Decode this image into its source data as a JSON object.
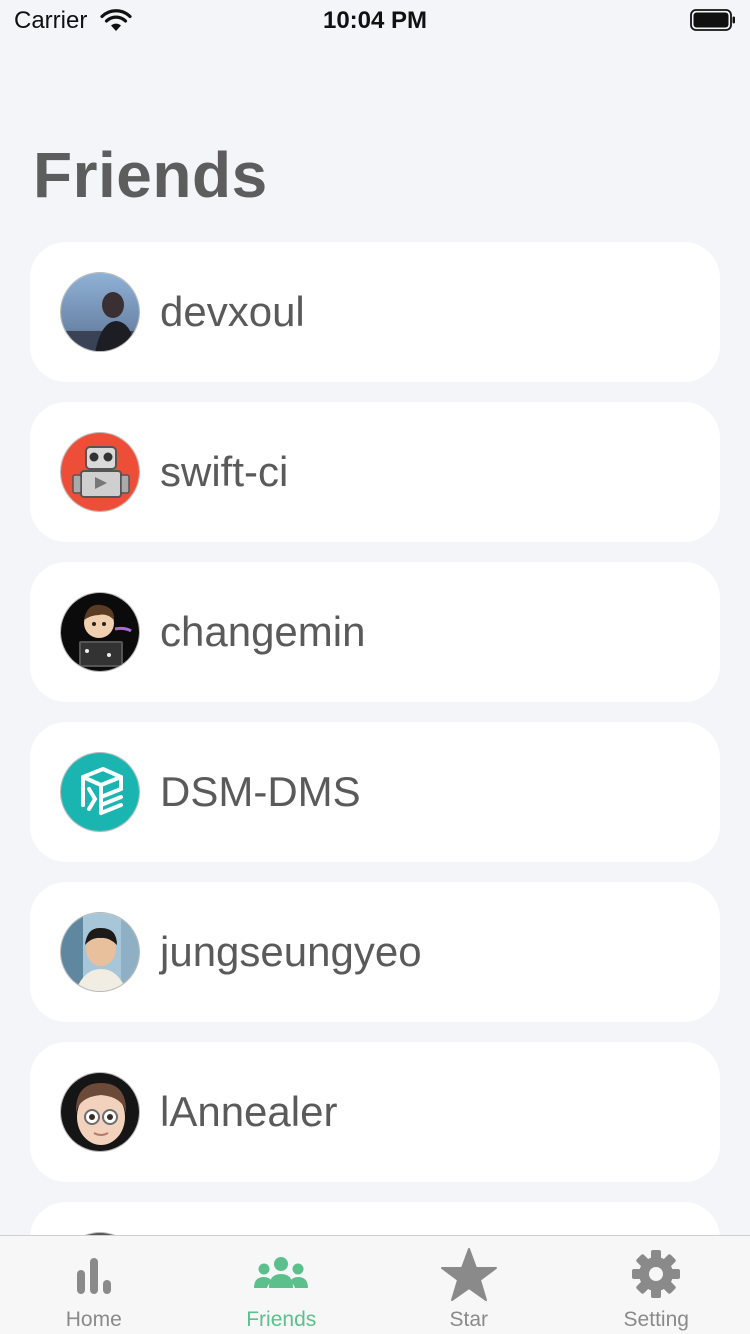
{
  "status_bar": {
    "carrier": "Carrier",
    "time": "10:04 PM"
  },
  "page": {
    "title": "Friends"
  },
  "friends": [
    {
      "name": "devxoul",
      "avatar": "photo-portrait-dusk"
    },
    {
      "name": "swift-ci",
      "avatar": "robot-icon"
    },
    {
      "name": "changemin",
      "avatar": "cartoon-boy"
    },
    {
      "name": "DSM-DMS",
      "avatar": "dms-logo"
    },
    {
      "name": "jungseungyeo",
      "avatar": "photo-portrait-window"
    },
    {
      "name": "lAnnealer",
      "avatar": "memoji-glasses"
    }
  ],
  "tabs": [
    {
      "label": "Home",
      "icon": "chart-bars-icon",
      "active": false
    },
    {
      "label": "Friends",
      "icon": "people-icon",
      "active": true
    },
    {
      "label": "Star",
      "icon": "star-icon",
      "active": false
    },
    {
      "label": "Setting",
      "icon": "gear-icon",
      "active": false
    }
  ],
  "colors": {
    "accent": "#5cc08c",
    "inactive": "#8a8a8a",
    "background": "#f4f5f9"
  }
}
